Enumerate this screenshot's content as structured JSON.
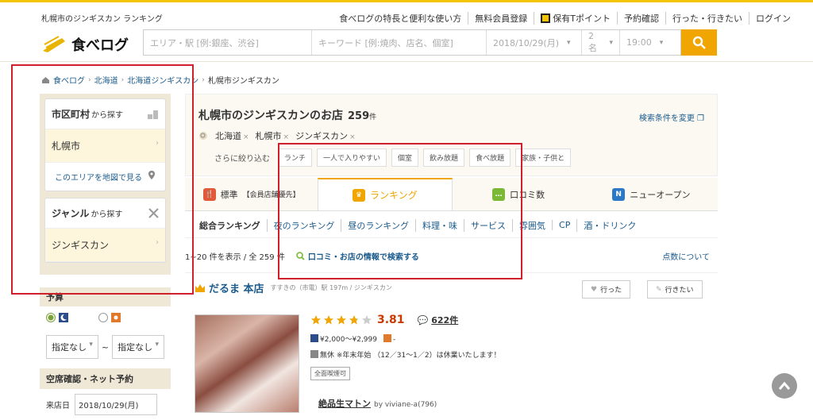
{
  "header": {
    "site_title": "札幌市のジンギスカン ランキング",
    "links": [
      "食べログの特長と便利な使い方",
      "無料会員登録",
      "保有Tポイント",
      "予約確認",
      "行った・行きたい",
      "ログイン"
    ],
    "logo_text": "食べログ",
    "search": {
      "area_placeholder": "エリア・駅 [例:銀座、渋谷]",
      "keyword_placeholder": "キーワード [例:焼肉、店名、個室]",
      "date": "2018/10/29(月)",
      "people": "2名",
      "time": "19:00"
    }
  },
  "breadcrumb": [
    "食べログ",
    "北海道",
    "北海道ジンギスカン",
    "札幌市ジンギスカン"
  ],
  "sidebar": {
    "city_head": "市区町村",
    "city_head_suffix": "から探す",
    "city_value": "札幌市",
    "map_link": "このエリアを地図で見る",
    "genre_head": "ジャンル",
    "genre_head_suffix": "から探す",
    "genre_value": "ジンギスカン",
    "budget_title": "予算",
    "budget_min": "指定なし",
    "budget_tilde": "~",
    "budget_max": "指定なし",
    "booking_title": "空席確認・ネット予約",
    "visit_label": "来店日",
    "visit_date": "2018/10/29(月)"
  },
  "results": {
    "title": "札幌市のジンギスカンのお店",
    "count": "259",
    "count_unit": "件",
    "change_conditions": "検索条件を変更",
    "tags": [
      "北海道",
      "札幌市",
      "ジンギスカン"
    ],
    "filter_label": "さらに絞り込む",
    "filters": [
      "ランチ",
      "一人で入りやすい",
      "個室",
      "飲み放題",
      "食べ放題",
      "家族・子供と"
    ]
  },
  "tabs": [
    {
      "label": "標準",
      "sub": "【会員店舗優先】",
      "icon_char": "🍴",
      "color": "#e05a3a"
    },
    {
      "label": "ランキング",
      "sub": "",
      "icon_char": "♛",
      "color": "#f0a500"
    },
    {
      "label": "口コミ数",
      "sub": "",
      "icon_char": "…",
      "color": "#7ab836"
    },
    {
      "label": "ニューオープン",
      "sub": "",
      "icon_char": "N",
      "color": "#2a78c6"
    }
  ],
  "subnav": [
    "総合ランキング",
    "夜のランキング",
    "昼のランキング",
    "料理・味",
    "サービス",
    "雰囲気",
    "CP",
    "酒・ドリンク"
  ],
  "countbar": {
    "showing": "1~20 件を表示 / 全 259 件",
    "review_search": "口コミ・お店の情報で検索する",
    "points": "点数について"
  },
  "store": {
    "name": "だるま 本店",
    "station_genre": "すすきの（市電）駅 197m / ジンギスカン",
    "went": "行った",
    "want": "行きたい",
    "score": "3.81",
    "reviews": "622件",
    "price_dinner": "¥2,000～¥2,999",
    "price_lunch": "-",
    "holiday": "無休 ※年末年始 （12／31～1／2）は休業いたします！",
    "smoking": "全面喫煙可",
    "review_title": "絶品生マトン",
    "review_by": "by viviane-a(796)"
  }
}
